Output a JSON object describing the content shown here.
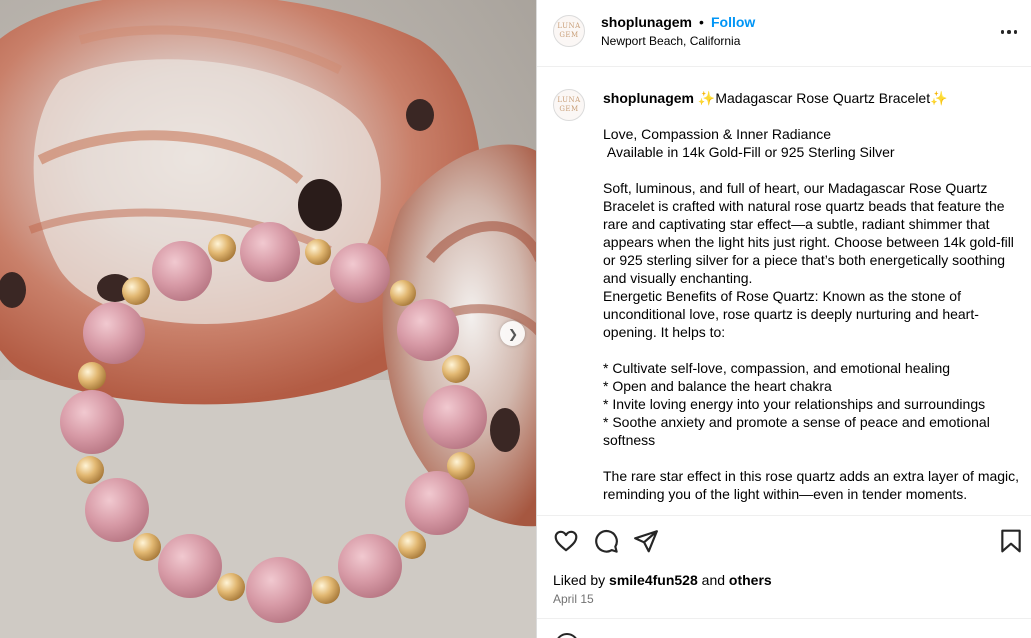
{
  "image": {
    "alt": "",
    "next_icon": "chevron-right-icon"
  },
  "header": {
    "avatar_lines": [
      "LUNA",
      "GEM"
    ],
    "username": "shoplunagem",
    "separator": "•",
    "follow_label": "Follow",
    "location": "Newport Beach, California",
    "more_icon": "more-horizontal-icon"
  },
  "caption": {
    "username": "shoplunagem",
    "text": " ✨Madagascar Rose Quartz Bracelet✨\n\nLove, Compassion & Inner Radiance\n Available in 14k Gold-Fill or 925 Sterling Silver\n\nSoft, luminous, and full of heart, our Madagascar Rose Quartz Bracelet is crafted with natural rose quartz beads that feature the rare and captivating star effect—a subtle, radiant shimmer that appears when the light hits just right. Choose between 14k gold-fill or 925 sterling silver for a piece that’s both energetically soothing and visually enchanting.\nEnergetic Benefits of Rose Quartz: Known as the stone of unconditional love, rose quartz is deeply nurturing and heart-opening. It helps to:\n\n* Cultivate self-love, compassion, and emotional healing\n* Open and balance the heart chakra\n* Invite loving energy into your relationships and surroundings\n* Soothe anxiety and promote a sense of peace and emotional softness\n\nThe rare star effect in this rose quartz adds an extra layer of magic, reminding you of the light within—even in tender moments."
  },
  "actions": {
    "icons": [
      "heart-icon",
      "comment-icon",
      "share-icon",
      "bookmark-icon"
    ],
    "liked_by_prefix": "Liked by",
    "liked_by_user": "smile4fun528",
    "liked_by_and": "and",
    "liked_by_others": "others",
    "date": "April 15"
  },
  "colors": {
    "link_blue": "#0095f6",
    "text": "#000000",
    "muted": "#737373",
    "border": "#dbdbdb"
  }
}
